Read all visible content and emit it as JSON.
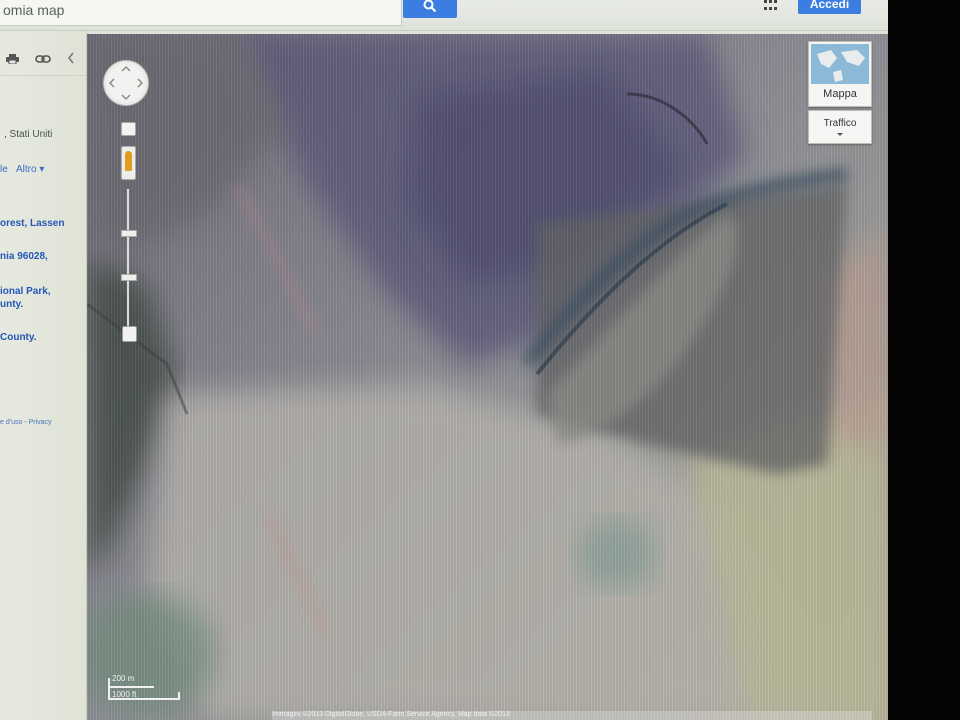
{
  "search": {
    "query": "omia map"
  },
  "header": {
    "signin_label": "Accedi"
  },
  "icons": {
    "search": "search-icon",
    "apps": "apps-grid-icon",
    "print": "print-icon",
    "link": "link-icon",
    "collapse": "chevron-left-icon",
    "pan": "pan-control-icon",
    "pegman": "street-view-pegman-icon"
  },
  "colors": {
    "accent": "#3b7de0",
    "link": "#2356b8",
    "pegman": "#e19b1f"
  },
  "sidebar": {
    "location_suffix": ", Stati Uniti",
    "more_prefix": "le",
    "more_label": "Altro ▾",
    "results": [
      "orest, Lassen",
      "nia 96028,",
      "ional Park,",
      "unty.",
      "County."
    ],
    "terms": "e d'uso - Privacy"
  },
  "map": {
    "type_label": "Mappa",
    "traffic_label": "Traffico",
    "scale_metric": "200 m",
    "scale_imperial": "1000 ft",
    "copyright": "Immagini ©2013 DigitalGlobe, USDA Farm Service Agency, Map data ©2013"
  }
}
